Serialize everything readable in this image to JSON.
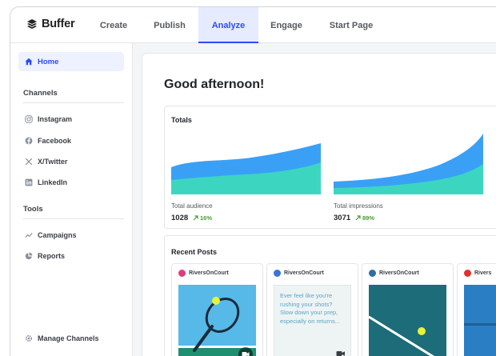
{
  "app": {
    "name": "Buffer"
  },
  "topnav": {
    "tabs": [
      {
        "label": "Create",
        "active": false
      },
      {
        "label": "Publish",
        "active": false
      },
      {
        "label": "Analyze",
        "active": true
      },
      {
        "label": "Engage",
        "active": false
      },
      {
        "label": "Start Page",
        "active": false
      }
    ]
  },
  "sidebar": {
    "home_label": "Home",
    "channels_title": "Channels",
    "channels": [
      {
        "label": "Instagram",
        "icon": "instagram-icon"
      },
      {
        "label": "Facebook",
        "icon": "facebook-icon"
      },
      {
        "label": "X/Twitter",
        "icon": "x-icon"
      },
      {
        "label": "LinkedIn",
        "icon": "linkedin-icon"
      }
    ],
    "tools_title": "Tools",
    "tools": [
      {
        "label": "Campaigns",
        "icon": "trend-icon"
      },
      {
        "label": "Reports",
        "icon": "pie-chart-icon"
      }
    ],
    "manage_label": "Manage Channels"
  },
  "main": {
    "greeting": "Good afternoon!",
    "totals": {
      "title": "Totals",
      "metrics": [
        {
          "label": "Total audience",
          "value": "1028",
          "change": "16%"
        },
        {
          "label": "Total impressions",
          "value": "3071",
          "change": "89%"
        }
      ]
    },
    "recent_posts": {
      "title": "Recent Posts",
      "posts": [
        {
          "account": "RiversOnCourt",
          "network": "instagram",
          "kind": "image",
          "has_video": true
        },
        {
          "account": "RiversOnCourt",
          "network": "facebook",
          "kind": "text",
          "text": "Ever feel like you're rushing your shots? Slow down your prep, especially on returns...",
          "has_video": true
        },
        {
          "account": "RiversOnCourt",
          "network": "linkedin",
          "kind": "image",
          "has_video": false
        },
        {
          "account": "Rivers",
          "network": "youtube",
          "kind": "image",
          "has_video": false
        }
      ]
    }
  },
  "colors": {
    "accent": "#2c4bff",
    "chart_blue": "#3aa0f5",
    "chart_teal": "#3cd6c0",
    "positive": "#4a9a35"
  }
}
